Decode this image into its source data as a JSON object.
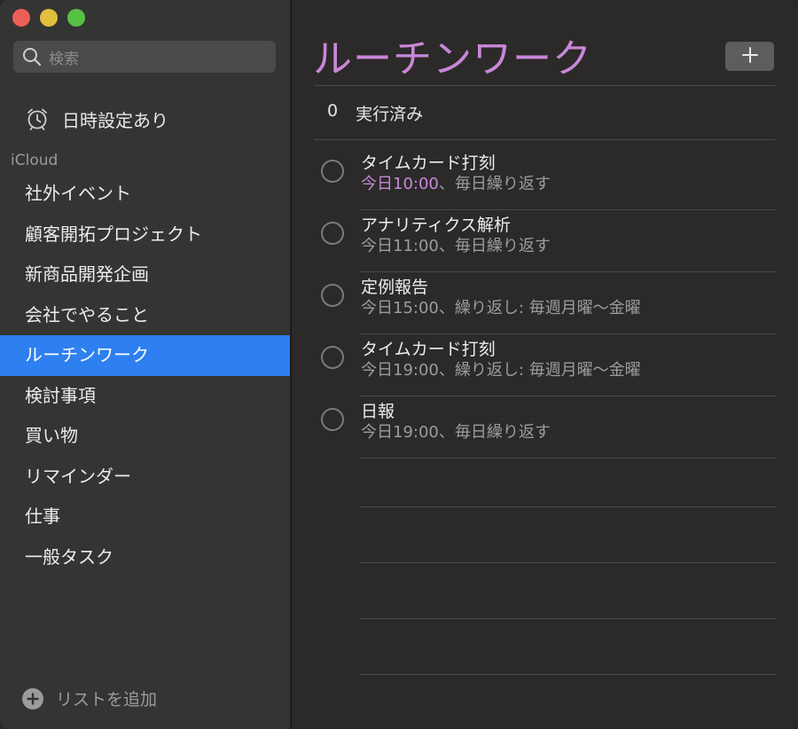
{
  "sidebar": {
    "search_placeholder": "検索",
    "scheduled_label": "日時設定あり",
    "group_label": "iCloud",
    "lists": [
      {
        "label": "社外イベント",
        "selected": false
      },
      {
        "label": "顧客開拓プロジェクト",
        "selected": false
      },
      {
        "label": "新商品開発企画",
        "selected": false
      },
      {
        "label": "会社でやること",
        "selected": false
      },
      {
        "label": "ルーチンワーク",
        "selected": true
      },
      {
        "label": "検討事項",
        "selected": false
      },
      {
        "label": "買い物",
        "selected": false
      },
      {
        "label": "リマインダー",
        "selected": false
      },
      {
        "label": "仕事",
        "selected": false
      },
      {
        "label": "一般タスク",
        "selected": false
      }
    ],
    "add_list_label": "リストを追加"
  },
  "main": {
    "title": "ルーチンワーク",
    "add_button_icon": "plus-icon",
    "completed_count": "0",
    "completed_label": "実行済み",
    "tasks": [
      {
        "title": "タイムカード打刻",
        "time": "今日10:00",
        "repeat": "、毎日繰り返す",
        "time_highlight": true
      },
      {
        "title": "アナリティクス解析",
        "time": "今日11:00",
        "repeat": "、毎日繰り返す",
        "time_highlight": false
      },
      {
        "title": "定例報告",
        "time": "今日15:00",
        "repeat": "、繰り返し: 毎週月曜〜金曜",
        "time_highlight": false
      },
      {
        "title": "タイムカード打刻",
        "time": "今日19:00",
        "repeat": "、繰り返し: 毎週月曜〜金曜",
        "time_highlight": false
      },
      {
        "title": "日報",
        "time": "今日19:00",
        "repeat": "、毎日繰り返す",
        "time_highlight": false
      }
    ]
  },
  "colors": {
    "accent": "#c987d8",
    "selection": "#2e7ff0",
    "close": "#ec5f57",
    "minimize": "#e1bf3c",
    "zoom": "#56c142"
  }
}
